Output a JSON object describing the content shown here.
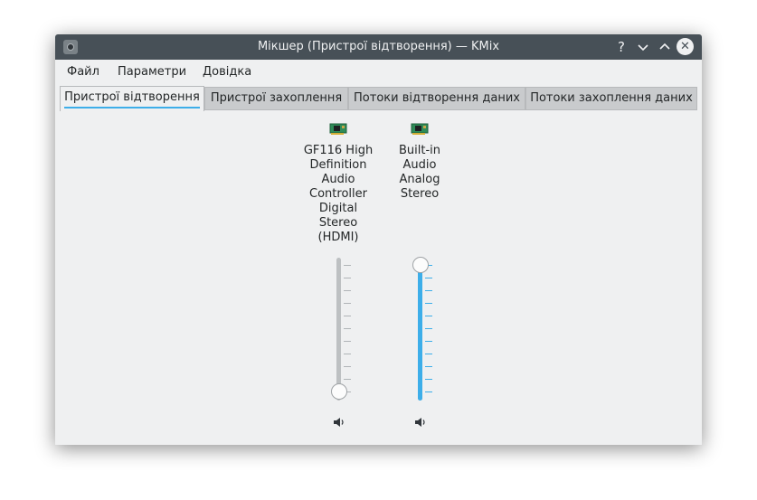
{
  "window": {
    "title": "Мікшер (Пристрої відтворення) — KMix",
    "buttons": {
      "help": "?",
      "minimize": "⌄",
      "maximize": "⌃",
      "close": "✕"
    }
  },
  "menu": {
    "file": "Файл",
    "settings": "Параметри",
    "help": "Довідка"
  },
  "tabs": [
    {
      "label": "Пристрої відтворення",
      "active": true
    },
    {
      "label": "Пристрої захоплення",
      "active": false
    },
    {
      "label": "Потоки відтворення даних",
      "active": false
    },
    {
      "label": "Потоки захоплення даних",
      "active": false
    }
  ],
  "devices": [
    {
      "label_lines": [
        "GF116 High",
        "Definition",
        "Audio",
        "Controller",
        "Digital",
        "Stereo",
        "(HDMI)"
      ],
      "icon": "sound-card-icon",
      "volume_percent": 0,
      "muted_icon": "speaker-icon"
    },
    {
      "label_lines": [
        "Built-in",
        "Audio",
        "Analog",
        "Stereo"
      ],
      "icon": "sound-card-icon",
      "volume_percent": 100,
      "muted_icon": "speaker-icon"
    }
  ],
  "colors": {
    "titlebar": "#475057",
    "accent": "#3daee9",
    "background": "#eff0f1"
  }
}
